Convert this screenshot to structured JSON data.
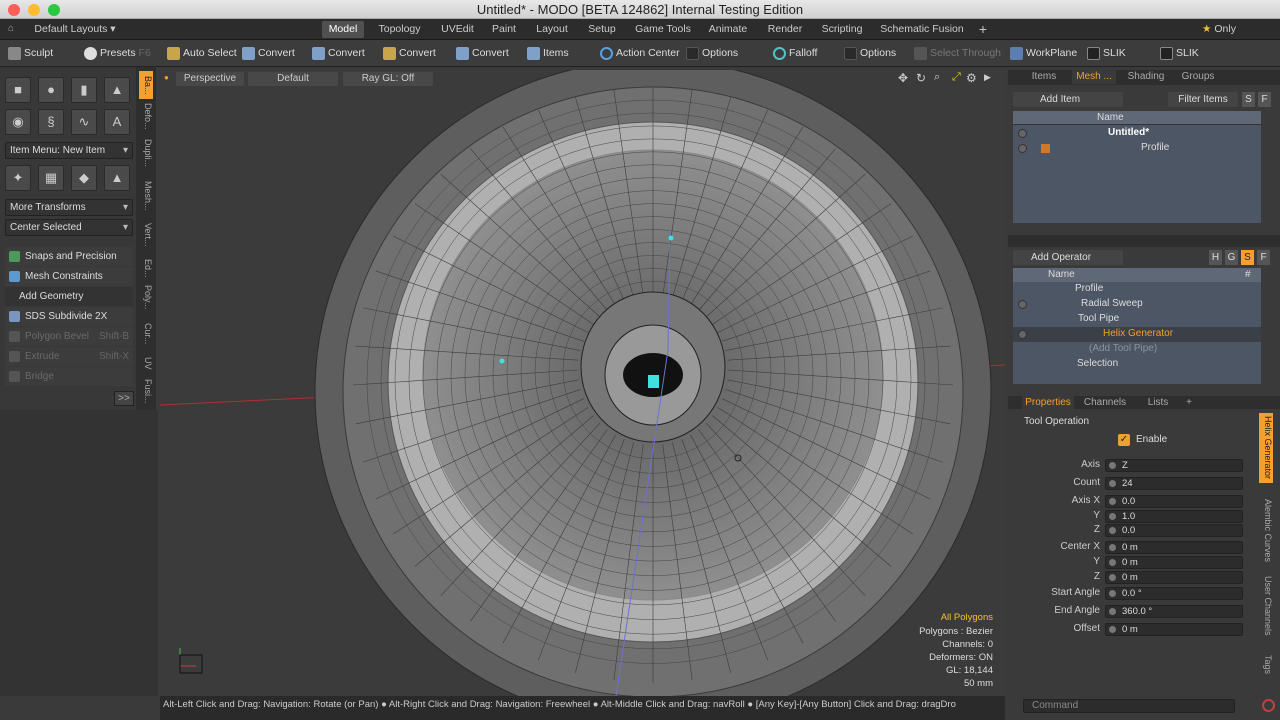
{
  "window": {
    "title": "Untitled* - MODO [BETA 124862] Internal Testing Edition"
  },
  "menubar": {
    "layouts": "Default Layouts ▾",
    "tabs": [
      "Model",
      "Topology",
      "UVEdit",
      "Paint",
      "Layout",
      "Setup",
      "Game Tools",
      "Animate",
      "Render",
      "Scripting",
      "Schematic Fusion"
    ],
    "plus": "+",
    "only": "Only"
  },
  "toolbar": {
    "sculpt": "Sculpt",
    "presets": "Presets",
    "presets_key": "F6",
    "auto_select": "Auto Select",
    "convert": "Convert",
    "items": "Items",
    "action_center": "Action Center",
    "options": "Options",
    "falloff": "Falloff",
    "select_through": "Select Through",
    "workplane": "WorkPlane",
    "slik": "SLIK"
  },
  "left": {
    "item_menu": "Item Menu: New Item",
    "more_transforms": "More Transforms",
    "center_selected": "Center Selected",
    "snaps": "Snaps and Precision",
    "mesh_constraints": "Mesh Constraints",
    "add_geometry": "Add Geometry",
    "sds": "SDS Subdivide 2X",
    "polygon_bevel": "Polygon Bevel",
    "polygon_bevel_key": "Shift-B",
    "extrude": "Extrude",
    "extrude_key": "Shift-X",
    "bridge": "Bridge",
    "more": ">>"
  },
  "vtabs": [
    "Ba...",
    "Defo...",
    "Dupli...",
    "Mesh...",
    "Vert...",
    "Ed...",
    "Poly...",
    "Cur...",
    "UV",
    "Fusi..."
  ],
  "viewport": {
    "perspective": "Perspective",
    "default": "Default",
    "raygl": "Ray GL: Off",
    "stats": {
      "all": "All Polygons",
      "polygons": "Polygons : Bezier",
      "channels": "Channels: 0",
      "deformers": "Deformers: ON",
      "gl": "GL: 18,144",
      "scale": "50 mm"
    }
  },
  "statusbar": {
    "text": "Alt-Left Click and Drag: Navigation: Rotate (or Pan) ● Alt-Right Click and Drag: Navigation: Freewheel ● Alt-Middle Click and Drag: navRoll ● [Any Key]-[Any Button] Click and Drag: dragDro"
  },
  "items_panel": {
    "tabs": [
      "Items",
      "Mesh ...",
      "Shading",
      "Groups"
    ],
    "add_item": "Add Item",
    "filter_items": "Filter Items",
    "s": "S",
    "f": "F",
    "col_name": "Name",
    "rows": [
      "Untitled*",
      "Profile"
    ]
  },
  "ops_panel": {
    "add_operator": "Add Operator",
    "h": "H",
    "g": "G",
    "s": "S",
    "f": "F",
    "col_name": "Name",
    "col_hash": "#",
    "rows": [
      "Profile",
      "Radial Sweep",
      "Tool Pipe",
      "Helix Generator",
      "(Add Tool Pipe)",
      "Selection"
    ]
  },
  "props": {
    "tabs": [
      "Properties",
      "Channels",
      "Lists",
      "+"
    ],
    "section": "Tool Operation",
    "enable": "Enable",
    "side_tabs": [
      "Helix Generator",
      "Alembic Curves",
      "User Channels",
      "Tags"
    ],
    "fields": [
      {
        "label": "Axis",
        "value": "Z"
      },
      {
        "label": "Count",
        "value": "24"
      },
      {
        "label": "Axis X",
        "value": "0.0"
      },
      {
        "label": "Y",
        "value": "1.0"
      },
      {
        "label": "Z",
        "value": "0.0"
      },
      {
        "label": "Center X",
        "value": "0 m"
      },
      {
        "label": "Y",
        "value": "0 m"
      },
      {
        "label": "Z",
        "value": "0 m"
      },
      {
        "label": "Start Angle",
        "value": "0.0 °"
      },
      {
        "label": "End Angle",
        "value": "360.0 °"
      },
      {
        "label": "Offset",
        "value": "0 m"
      }
    ],
    "command": "Command"
  },
  "colors": {
    "accent": "#f3a030",
    "select": "#5b6a80",
    "bg": "#3a3a3a"
  }
}
